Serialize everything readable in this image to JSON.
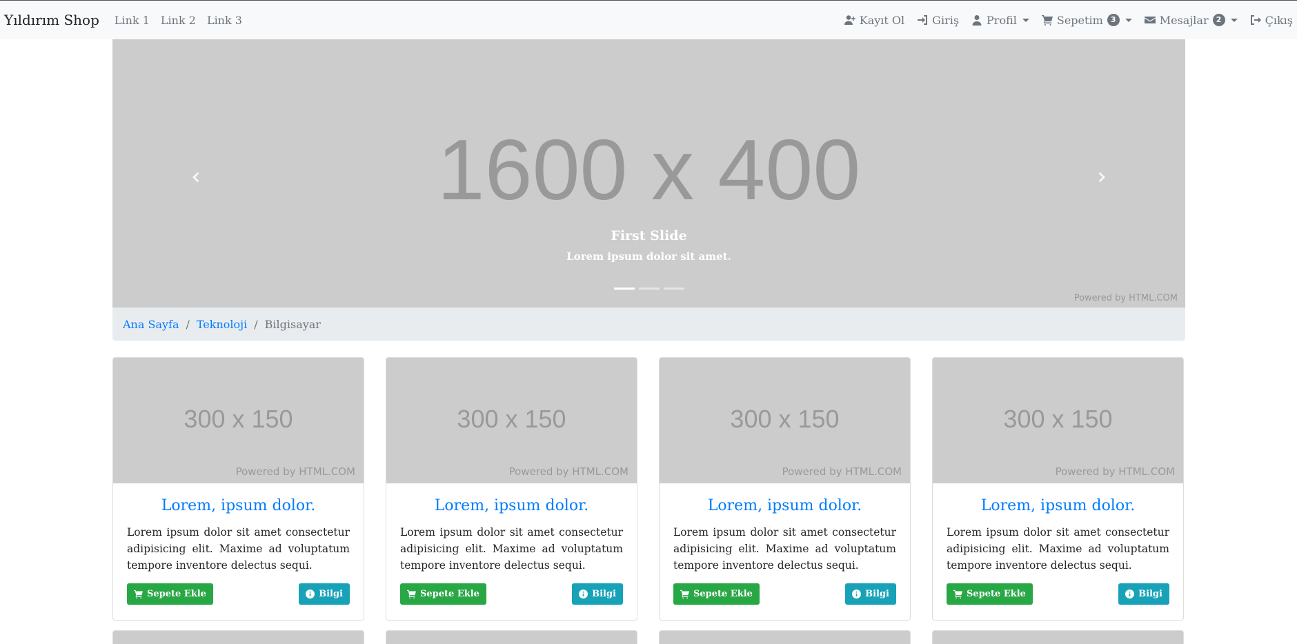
{
  "navbar": {
    "brand": "Yıldırım Shop",
    "links": [
      "Link 1",
      "Link 2",
      "Link 3"
    ],
    "register": "Kayıt Ol",
    "login": "Giriş",
    "profile": "Profil",
    "cart": "Sepetim",
    "cart_count": "3",
    "messages": "Mesajlar",
    "messages_count": "2",
    "logout": "Çıkış"
  },
  "carousel": {
    "image_text": "1600 x 400",
    "caption_title": "First Slide",
    "caption_text": "Lorem ipsum dolor sit amet.",
    "powered": "Powered by HTML.COM",
    "slide_count": 3,
    "active_slide": 1
  },
  "breadcrumb": {
    "items": [
      "Ana Sayfa",
      "Teknoloji"
    ],
    "active": "Bilgisayar",
    "separator": "/"
  },
  "cards": [
    {
      "image_text": "300 x 150",
      "powered": "Powered by HTML.COM",
      "title": "Lorem, ipsum dolor.",
      "text": "Lorem ipsum dolor sit amet consectetur adipisicing elit. Maxime ad voluptatum tempore inventore delectus sequi.",
      "add_button": "Sepete Ekle",
      "info_button": "Bilgi"
    },
    {
      "image_text": "300 x 150",
      "powered": "Powered by HTML.COM",
      "title": "Lorem, ipsum dolor.",
      "text": "Lorem ipsum dolor sit amet consectetur adipisicing elit. Maxime ad voluptatum tempore inventore delectus sequi.",
      "add_button": "Sepete Ekle",
      "info_button": "Bilgi"
    },
    {
      "image_text": "300 x 150",
      "powered": "Powered by HTML.COM",
      "title": "Lorem, ipsum dolor.",
      "text": "Lorem ipsum dolor sit amet consectetur adipisicing elit. Maxime ad voluptatum tempore inventore delectus sequi.",
      "add_button": "Sepete Ekle",
      "info_button": "Bilgi"
    },
    {
      "image_text": "300 x 150",
      "powered": "Powered by HTML.COM",
      "title": "Lorem, ipsum dolor.",
      "text": "Lorem ipsum dolor sit amet consectetur adipisicing elit. Maxime ad voluptatum tempore inventore delectus sequi.",
      "add_button": "Sepete Ekle",
      "info_button": "Bilgi"
    }
  ],
  "colors": {
    "primary": "#007bff",
    "success": "#28a745",
    "info": "#17a2b8",
    "navbar_bg": "#f8f9fa",
    "placeholder_bg": "#cccccc"
  },
  "icons": {
    "register": "user-plus-icon",
    "login": "sign-in-icon",
    "profile": "user-icon",
    "cart": "shopping-cart-icon",
    "messages": "envelope-icon",
    "logout": "sign-out-icon",
    "carousel_prev": "chevron-left-icon",
    "carousel_next": "chevron-right-icon",
    "add_to_cart": "shopping-cart-icon",
    "info": "info-circle-icon"
  }
}
